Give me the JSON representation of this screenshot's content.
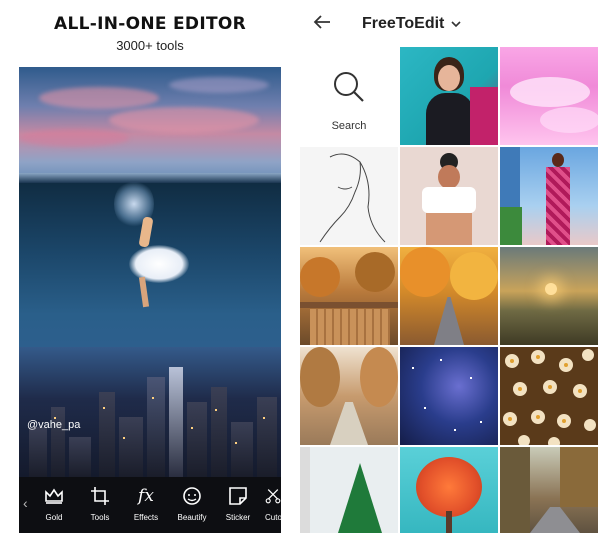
{
  "promo": {
    "headline": "ALL-IN-ONE EDITOR",
    "subline": "3000+ tools"
  },
  "editor": {
    "watermark": "@vahe_pa",
    "tools": [
      {
        "label": "Gold",
        "icon": "crown-icon"
      },
      {
        "label": "Tools",
        "icon": "crop-icon"
      },
      {
        "label": "Effects",
        "icon": "fx-icon"
      },
      {
        "label": "Beautify",
        "icon": "face-icon"
      },
      {
        "label": "Sticker",
        "icon": "sticker-icon"
      },
      {
        "label": "Cuto",
        "icon": "cutout-icon"
      }
    ]
  },
  "gallery": {
    "title": "FreeToEdit",
    "search_label": "Search",
    "thumbnails": [
      {
        "name": "portrait-teal",
        "color": "#2cb7c4"
      },
      {
        "name": "pink-clouds",
        "color": "#f08ad8"
      },
      {
        "name": "line-drawing",
        "color": "#f4f4f4"
      },
      {
        "name": "illustration-figure",
        "color": "#e9d8d2"
      },
      {
        "name": "pink-outfit",
        "color": "#8ab7e0"
      },
      {
        "name": "boardwalk",
        "color": "#b97a3c"
      },
      {
        "name": "autumn-road",
        "color": "#d48a2a"
      },
      {
        "name": "sunset-grass",
        "color": "#6f6a44"
      },
      {
        "name": "tree-path",
        "color": "#c79b6e"
      },
      {
        "name": "starry-sky",
        "color": "#2a3d8c"
      },
      {
        "name": "daisies",
        "color": "#a0713a"
      },
      {
        "name": "green-tree",
        "color": "#e9eef0"
      },
      {
        "name": "orange-tree",
        "color": "#36b7c0"
      },
      {
        "name": "forest-road",
        "color": "#8a7354"
      }
    ]
  }
}
